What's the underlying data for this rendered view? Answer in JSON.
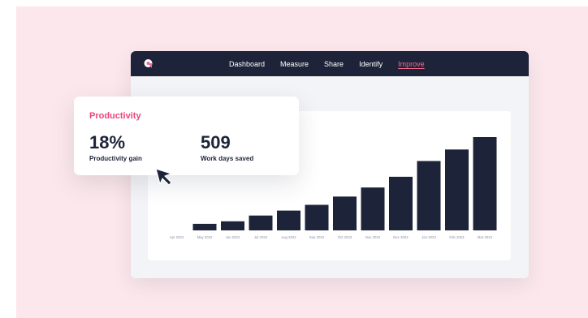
{
  "nav": {
    "items": [
      {
        "label": "Dashboard"
      },
      {
        "label": "Measure"
      },
      {
        "label": "Share"
      },
      {
        "label": "Identify"
      },
      {
        "label": "Improve",
        "active": true
      }
    ],
    "logo_icon": "chat-bubble-logo-icon"
  },
  "stats": {
    "title": "Productivity",
    "items": [
      {
        "value": "18%",
        "label": "Productivity gain"
      },
      {
        "value": "509",
        "label": "Work days saved"
      }
    ]
  },
  "colors": {
    "accent": "#e8457a",
    "nav_bg": "#1d2338",
    "bar": "#1d2338",
    "page_bg": "#fce8ec"
  },
  "cursor_icon": "mouse-pointer-icon",
  "chart_data": {
    "type": "bar",
    "categories": [
      "Apr 2022",
      "May 2022",
      "Jun 2022",
      "Jul 2022",
      "Aug 2022",
      "Sep 2022",
      "Oct 2022",
      "Nov 2022",
      "Dec 2022",
      "Jan 2023",
      "Feb 2023",
      "Mar 2023"
    ],
    "values": [
      0,
      8,
      11,
      18,
      24,
      31,
      41,
      52,
      65,
      84,
      98,
      113
    ],
    "title": "",
    "xlabel": "",
    "ylabel": "",
    "ylim": [
      0,
      115
    ],
    "grid": false,
    "legend": "none"
  }
}
